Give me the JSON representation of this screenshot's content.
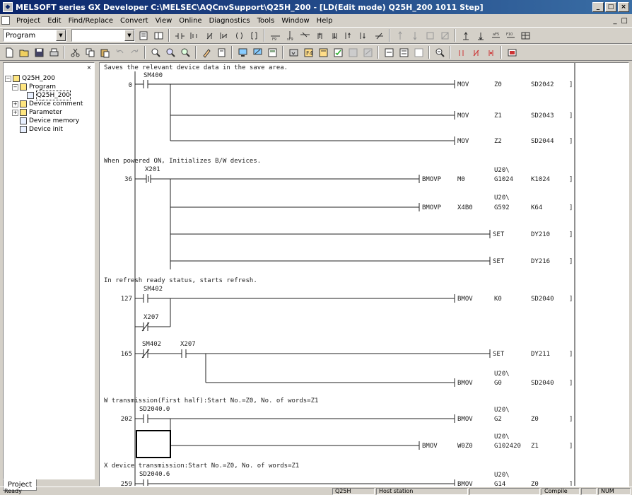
{
  "window": {
    "title": "MELSOFT series GX Developer C:\\MELSEC\\AQCnvSupport\\Q25H_200 - [LD(Edit mode)   Q25H_200   1011 Step]",
    "controls": [
      "_",
      "□",
      "×"
    ]
  },
  "menu": {
    "items": [
      "Project",
      "Edit",
      "Find/Replace",
      "Convert",
      "View",
      "Online",
      "Diagnostics",
      "Tools",
      "Window",
      "Help"
    ],
    "mdi_controls": [
      "_",
      "□"
    ]
  },
  "toolbar1": {
    "program_select": "Program",
    "second_select": ""
  },
  "project_tree": {
    "close_label": "×",
    "items": [
      {
        "label": "Q25H_200",
        "level": 0,
        "expander": "−"
      },
      {
        "label": "Program",
        "level": 1,
        "expander": "−"
      },
      {
        "label": "Q25H_200",
        "level": 2,
        "expander": ""
      },
      {
        "label": "Device comment",
        "level": 1,
        "expander": "+"
      },
      {
        "label": "Parameter",
        "level": 1,
        "expander": "+"
      },
      {
        "label": "Device memory",
        "level": 1,
        "expander": ""
      },
      {
        "label": "Device init",
        "level": 1,
        "expander": ""
      }
    ],
    "tab_label": "Project"
  },
  "ladder": {
    "comments": [
      "Saves the relevant device data in the save area.",
      "When powered ON, Initializes B/W devices.",
      "In refresh ready status, starts refresh.",
      "W transmission(First half):Start No.=Z0, No. of words=Z1",
      "X device transmission:Start No.=Z0, No. of words=Z1"
    ],
    "steps": [
      "0",
      "36",
      "127",
      "165",
      "202",
      "259"
    ],
    "contacts": [
      "SM400",
      "X201",
      "SM402",
      "X207",
      "SM402",
      "X207",
      "SD2040.0",
      "SD2040.6"
    ],
    "instructions": [
      {
        "op": "MOV",
        "s1": "Z0",
        "s2": "SD2042"
      },
      {
        "op": "MOV",
        "s1": "Z1",
        "s2": "SD2043"
      },
      {
        "op": "MOV",
        "s1": "Z2",
        "s2": "SD2044"
      },
      {
        "op": "BMOVP",
        "s1": "M0",
        "s2pre": "U20\\",
        "s2": "G1024",
        "s3": "K1024"
      },
      {
        "op": "BMOVP",
        "s1": "X4B0",
        "s2pre": "U20\\",
        "s2": "G592",
        "s3": "K64"
      },
      {
        "op": "SET",
        "s1": "DY210"
      },
      {
        "op": "SET",
        "s1": "DY216"
      },
      {
        "op": "BMOV",
        "s1": "K0",
        "s2": "SD2040"
      },
      {
        "op": "SET",
        "s1": "DY211"
      },
      {
        "op": "BMOV",
        "s1pre": "U20\\",
        "s1": "G0",
        "s2": "SD2040"
      },
      {
        "op": "BMOV",
        "s1pre": "U20\\",
        "s1": "G2",
        "s2": "Z0"
      },
      {
        "op": "BMOV",
        "s1": "W0Z0",
        "s2pre": "U20\\",
        "s2": "G102420",
        "s3": "Z1"
      },
      {
        "op": "BMOV",
        "s1pre": "U20\\",
        "s1": "G14",
        "s2": "Z0"
      }
    ]
  },
  "status": {
    "ready": "Ready",
    "cpu": "Q25H",
    "station": "Host station",
    "compile": "Compile",
    "mode": "NUM"
  }
}
